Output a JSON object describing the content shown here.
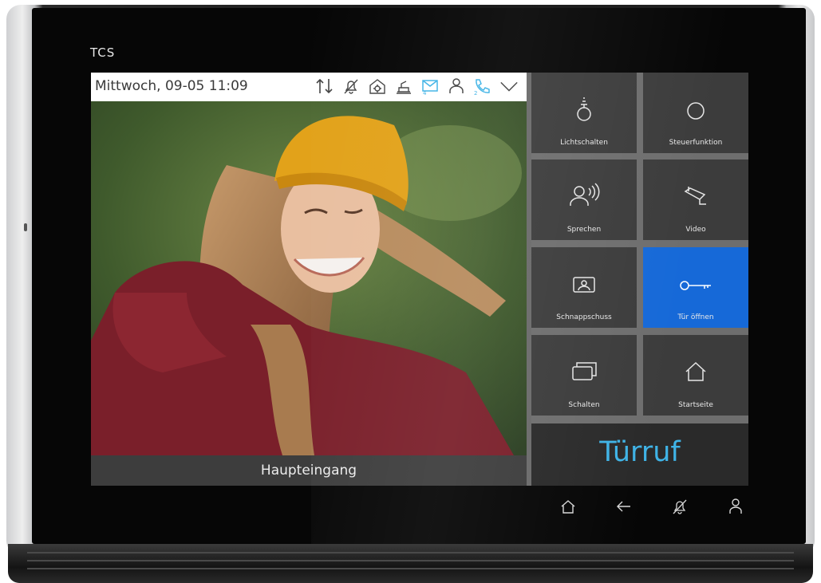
{
  "brand": {
    "logo_text": "TCS"
  },
  "status": {
    "datetime": "Mittwoch, 09-05 11:09",
    "icons": [
      "arrows-up-down-icon",
      "bell-muted-icon",
      "settings-house-icon",
      "door-lock-icon",
      "mail-icon",
      "person-icon",
      "phone-icon",
      "chevron-down-icon"
    ],
    "accent": "#3fb3e6"
  },
  "video": {
    "caption": "Haupteingang"
  },
  "tiles": [
    {
      "label": "Lichtschalten",
      "icon": "lightbulb-icon"
    },
    {
      "label": "Steuerfunktion",
      "icon": "circle-icon"
    },
    {
      "label": "Sprechen",
      "icon": "speak-icon"
    },
    {
      "label": "Video",
      "icon": "camera-icon"
    },
    {
      "label": "Schnappschuss",
      "icon": "snapshot-icon"
    },
    {
      "label": "Tür öffnen",
      "icon": "key-icon",
      "active": true
    },
    {
      "label": "Schalten",
      "icon": "switch-icon"
    },
    {
      "label": "Startseite",
      "icon": "home-icon"
    }
  ],
  "call": {
    "label": "Türruf"
  },
  "softkeys": [
    "home-icon",
    "back-arrow-icon",
    "bell-muted-icon",
    "person-icon"
  ],
  "colors": {
    "active_tile": "#1669d8",
    "tile_bg": "#3c3c3c",
    "call_text": "#3fb3e6"
  }
}
